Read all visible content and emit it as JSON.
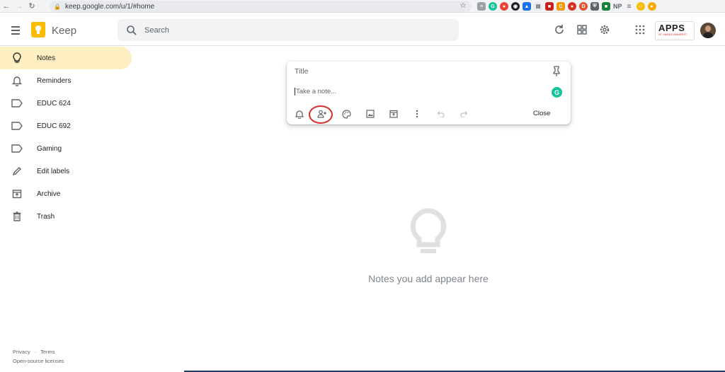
{
  "browser": {
    "url": "keep.google.com/u/1/#home",
    "extensions_text": "NP"
  },
  "header": {
    "app_title": "Keep",
    "search_placeholder": "Search",
    "brand_logo_text": "APPS",
    "brand_logo_subtext": "AT UMASS AMHERST"
  },
  "sidebar": {
    "items": [
      {
        "label": "Notes",
        "icon": "lightbulb-icon",
        "active": true
      },
      {
        "label": "Reminders",
        "icon": "bell-icon"
      },
      {
        "label": "EDUC 624",
        "icon": "label-icon"
      },
      {
        "label": "EDUC 692",
        "icon": "label-icon"
      },
      {
        "label": "Gaming",
        "icon": "label-icon"
      },
      {
        "label": "Edit labels",
        "icon": "pencil-icon"
      },
      {
        "label": "Archive",
        "icon": "archive-icon"
      },
      {
        "label": "Trash",
        "icon": "trash-icon"
      }
    ]
  },
  "composer": {
    "title_placeholder": "Title",
    "body_placeholder": "Take a note...",
    "close_label": "Close",
    "grammarly_badge": "G",
    "tools": [
      "remind-me-icon",
      "collaborator-icon",
      "palette-icon",
      "image-icon",
      "archive-icon",
      "more-icon",
      "undo-icon",
      "redo-icon"
    ]
  },
  "empty_state": {
    "message": "Notes you add appear here"
  },
  "footer": {
    "privacy": "Privacy",
    "separator": "·",
    "terms": "Terms",
    "licenses": "Open-source licenses"
  },
  "colors": {
    "active_item_bg": "#feefc3",
    "logo_yellow": "#fbbc04",
    "highlight_ring": "#d32f2f",
    "grammarly": "#15c39a"
  }
}
